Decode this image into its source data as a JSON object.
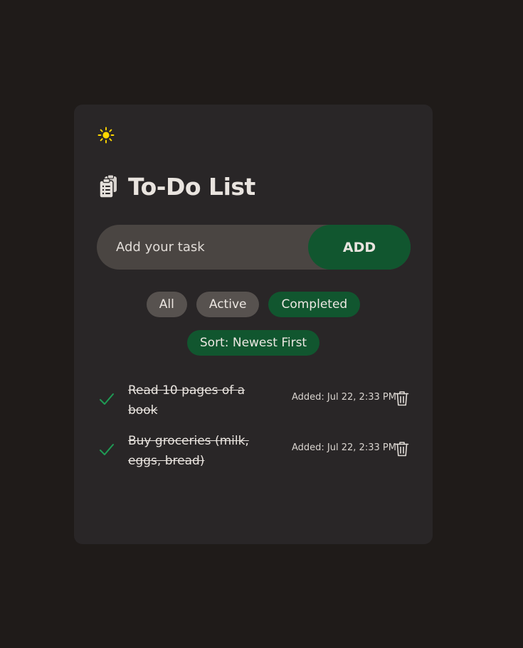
{
  "colors": {
    "page_background": "#1f1b19",
    "card_background": "#292627",
    "accent": "#11562f",
    "pill_inactive": "#57524f",
    "sun_icon": "#ffd800",
    "check_icon": "#1f9a54"
  },
  "theme_toggle": {
    "icon": "sun-icon"
  },
  "header": {
    "icon": "clipboard-icon",
    "title": "To-Do List"
  },
  "add_form": {
    "placeholder": "Add your task",
    "value": "",
    "button_label": "ADD"
  },
  "filters": {
    "items": [
      {
        "label": "All",
        "selected": false
      },
      {
        "label": "Active",
        "selected": false
      },
      {
        "label": "Completed",
        "selected": true
      }
    ]
  },
  "sort": {
    "label": "Sort: Newest First"
  },
  "tasks": [
    {
      "text": "Read 10 pages of a book",
      "completed": true,
      "added": "Added: Jul 22, 2:33 PM"
    },
    {
      "text": "Buy groceries (milk, eggs, bread)",
      "completed": true,
      "added": "Added: Jul 22, 2:33 PM"
    }
  ]
}
